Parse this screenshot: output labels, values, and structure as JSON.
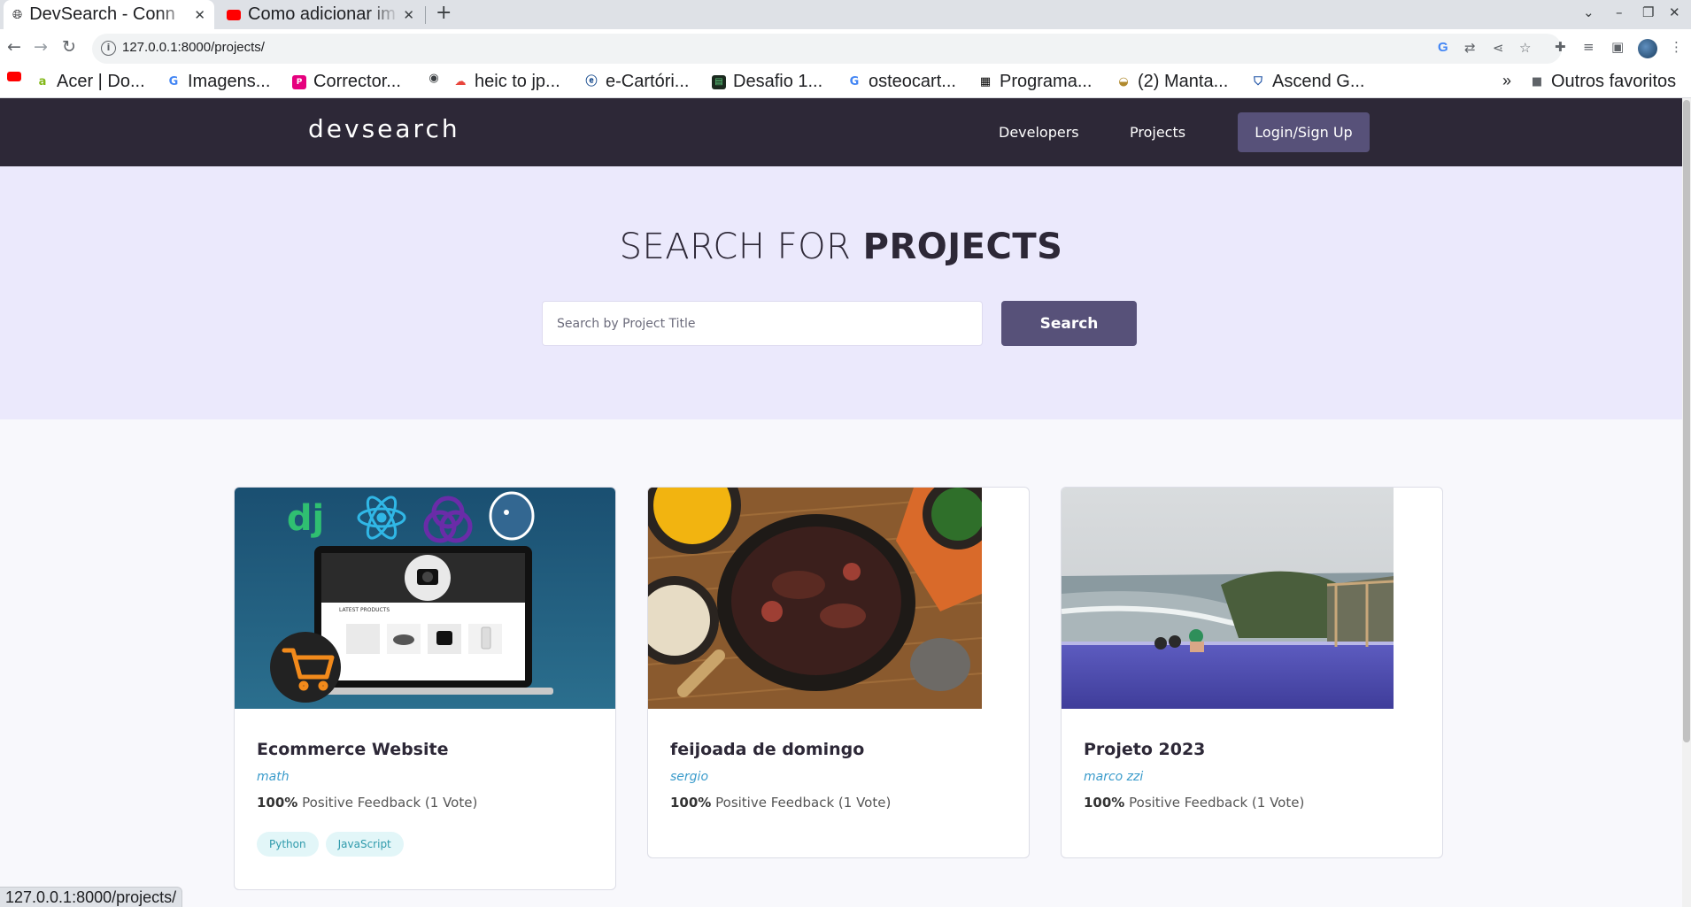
{
  "browser": {
    "tabs": [
      {
        "title": "DevSearch - Conn",
        "active": true
      },
      {
        "title": "Como adicionar im",
        "active": false
      }
    ],
    "new_tab_label": "+",
    "url": "127.0.0.1:8000/projects/",
    "bookmarks": [
      {
        "label": "",
        "icon": "youtube-icon"
      },
      {
        "label": "Acer | Do...",
        "icon": "acer-icon"
      },
      {
        "label": "Imagens...",
        "icon": "google-icon"
      },
      {
        "label": "Corrector...",
        "icon": "corrector-icon"
      },
      {
        "label": "",
        "icon": "globe-icon"
      },
      {
        "label": "heic to jp...",
        "icon": "cloud-icon"
      },
      {
        "label": "e-Cartóri...",
        "icon": "ecartorio-icon"
      },
      {
        "label": "Desafio 1...",
        "icon": "desafio-icon"
      },
      {
        "label": "osteocart...",
        "icon": "google-icon"
      },
      {
        "label": "Programa...",
        "icon": "grid-icon"
      },
      {
        "label": "(2) Manta...",
        "icon": "manta-icon"
      },
      {
        "label": "Ascend G...",
        "icon": "shield-icon"
      }
    ],
    "bookmarks_more": "»",
    "other_bookmarks": "Outros favoritos",
    "status_url": "127.0.0.1:8000/projects/"
  },
  "site": {
    "logo": "devsearch",
    "nav": {
      "developers": "Developers",
      "projects": "Projects",
      "login": "Login/Sign Up"
    },
    "hero": {
      "title_light": "SEARCH FOR ",
      "title_bold": "PROJECTS"
    },
    "search": {
      "placeholder": "Search by Project Title",
      "button": "Search"
    },
    "projects": [
      {
        "title": "Ecommerce Website",
        "author": "math",
        "feedback_pct": "100%",
        "feedback_text": "Positive Feedback (1 Vote)",
        "tags": [
          "Python",
          "JavaScript"
        ]
      },
      {
        "title": "feijoada de domingo",
        "author": "sergio",
        "feedback_pct": "100%",
        "feedback_text": "Positive Feedback (1 Vote)",
        "tags": []
      },
      {
        "title": "Projeto 2023",
        "author": "marco zzi",
        "feedback_pct": "100%",
        "feedback_text": "Positive Feedback (1 Vote)",
        "tags": []
      }
    ],
    "ecommerce_mock": {
      "heading": "LATEST PRODUCTS",
      "logos": [
        "dj"
      ]
    }
  },
  "colors": {
    "header_bg": "#2d2837",
    "hero_bg": "#ebe9fc",
    "accent": "#575179",
    "author": "#3a9bcb",
    "tag_bg": "#e2f6f8"
  }
}
